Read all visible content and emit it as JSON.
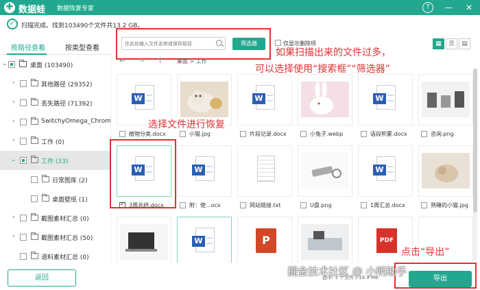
{
  "app": {
    "brand": "数据蛙",
    "subtitle": "数据恢复专家",
    "help": "?",
    "minimize": "—",
    "close": "✕"
  },
  "status": {
    "text": "扫描完成。找到103490个文件共13.2 GB。"
  },
  "tabs": [
    {
      "label": "按路径查看"
    },
    {
      "label": "按类型查看"
    }
  ],
  "tree": [
    {
      "label": "桌面 (103490)"
    },
    {
      "label": "其他路径 (29352)"
    },
    {
      "label": "丢失路径 (71392)"
    },
    {
      "label": "SwitchyOmega_Chromium"
    },
    {
      "label": "工作 (0)"
    },
    {
      "label": "工作 (33)"
    },
    {
      "label": "日常图库 (2)"
    },
    {
      "label": "桌面壁纸 (1)"
    },
    {
      "label": "截图素材汇总 (0)"
    },
    {
      "label": "截图素材汇总 (50)"
    },
    {
      "label": "语料素材汇总 (0)"
    }
  ],
  "search": {
    "placeholder": "在此处输入文件名称或保存路径"
  },
  "filter": {
    "label": "筛选器"
  },
  "only_deleted": {
    "label": "仅显示删除项"
  },
  "breadcrumb": "桌面 > 工作",
  "nav": {
    "back": "←",
    "forward": "→",
    "up": "↑"
  },
  "files": [
    {
      "name": "植物分类.docx",
      "type": "word"
    },
    {
      "name": "小猫.jpg",
      "type": "cat"
    },
    {
      "name": "片段记录.docx",
      "type": "word"
    },
    {
      "name": "小兔子.webp",
      "type": "bunny"
    },
    {
      "name": "语段积累.docx",
      "type": "word"
    },
    {
      "name": "咨询.png",
      "type": "office"
    },
    {
      "name": "3周总结.docx",
      "type": "word",
      "checked": true
    },
    {
      "name": "附：使...ocx",
      "type": "word"
    },
    {
      "name": "网站链接.txt",
      "type": "txt"
    },
    {
      "name": "U盘.png",
      "type": "usb"
    },
    {
      "name": "1周汇总.docx",
      "type": "word"
    },
    {
      "name": "熟睡的小猫.jpg",
      "type": "kitten"
    },
    {
      "name": "",
      "type": "laptop"
    },
    {
      "name": "",
      "type": "word"
    },
    {
      "name": "",
      "type": "ppt",
      "glyph": "P"
    },
    {
      "name": "",
      "type": "desk"
    },
    {
      "name": "",
      "type": "pdf",
      "glyph": "PDF"
    },
    {
      "name": "",
      "type": "blank"
    }
  ],
  "annotations": {
    "search_tip_line1": "如果扫描出来的文件过多，",
    "search_tip_line2": "可以选择使用“搜索框”“筛选器”",
    "select_tip": "选择文件进行恢复",
    "export_tip": "点击“导出”"
  },
  "bottom": {
    "info": "选中: 1 个文件 / 19.9 MB",
    "back": "返回",
    "export": "导出"
  },
  "watermark": "掘金技术社区 @ 小明助手",
  "colors": {
    "accent": "#22a88e",
    "annotation": "#e03030"
  }
}
